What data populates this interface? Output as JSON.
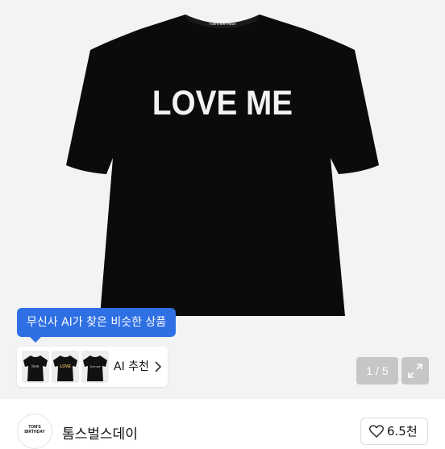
{
  "product": {
    "print_text": "LOVE ME",
    "neck_label": "TOM'S BIRTHDAY",
    "background_color": "#f2f3f5",
    "shirt_color": "#0b0b0b"
  },
  "ai_recommend": {
    "tooltip": "무신사 AI가 찾은 비슷한 상품",
    "label": "AI 추천",
    "thumb_print_1": "love",
    "thumb_print_2": "LOVE",
    "thumb_print_3": "love me",
    "accent_color": "#2f6fe4",
    "chevron_icon": "chevron-right-icon"
  },
  "gallery": {
    "counter": "1 / 5",
    "expand_icon": "expand-icon"
  },
  "brand": {
    "logo_text": "TOM'S BIRTHDAY",
    "name": "톰스벌스데이",
    "like_count": "6.5천",
    "like_icon": "heart-outline-icon"
  }
}
